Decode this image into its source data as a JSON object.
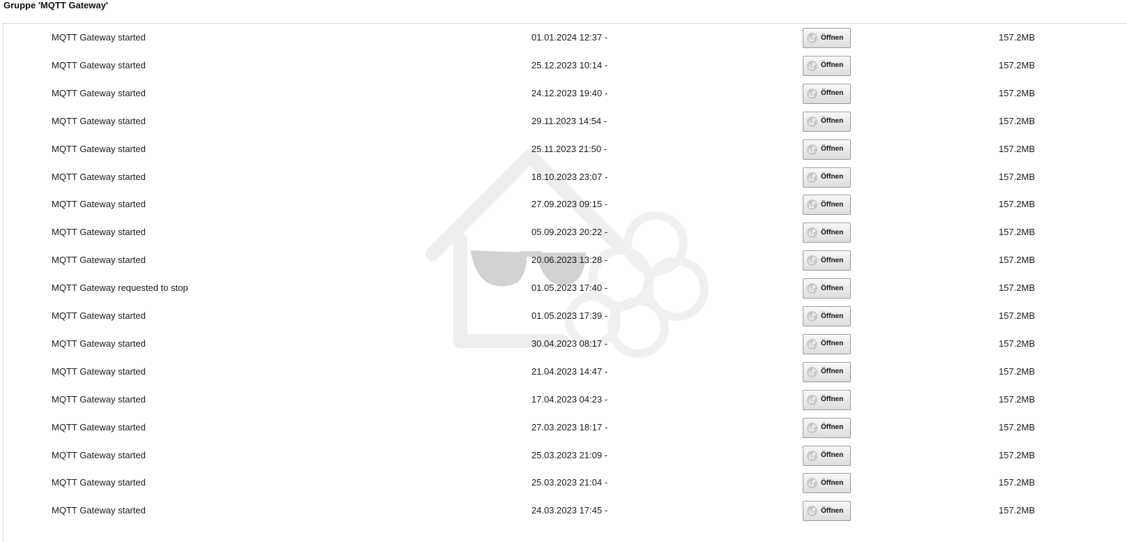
{
  "page": {
    "title": "Gruppe 'MQTT Gateway'"
  },
  "watermark": {
    "icon": "home-sunglasses-raspberry-logo"
  },
  "open_button": {
    "label": "Öffnen",
    "icon": "open-external-icon"
  },
  "rows": [
    {
      "message": "MQTT Gateway started",
      "date": "01.01.2024 12:37 -",
      "size": "157.2MB"
    },
    {
      "message": "MQTT Gateway started",
      "date": "25.12.2023 10:14 -",
      "size": "157.2MB"
    },
    {
      "message": "MQTT Gateway started",
      "date": "24.12.2023 19:40 -",
      "size": "157.2MB"
    },
    {
      "message": "MQTT Gateway started",
      "date": "29.11.2023 14:54 -",
      "size": "157.2MB"
    },
    {
      "message": "MQTT Gateway started",
      "date": "25.11.2023 21:50 -",
      "size": "157.2MB"
    },
    {
      "message": "MQTT Gateway started",
      "date": "18.10.2023 23:07 -",
      "size": "157.2MB"
    },
    {
      "message": "MQTT Gateway started",
      "date": "27.09.2023 09:15 -",
      "size": "157.2MB"
    },
    {
      "message": "MQTT Gateway started",
      "date": "05.09.2023 20:22 -",
      "size": "157.2MB"
    },
    {
      "message": "MQTT Gateway started",
      "date": "20.06.2023 13:28 -",
      "size": "157.2MB"
    },
    {
      "message": "MQTT Gateway requested to stop",
      "date": "01.05.2023 17:40 -",
      "size": "157.2MB"
    },
    {
      "message": "MQTT Gateway started",
      "date": "01.05.2023 17:39 -",
      "size": "157.2MB"
    },
    {
      "message": "MQTT Gateway started",
      "date": "30.04.2023 08:17 -",
      "size": "157.2MB"
    },
    {
      "message": "MQTT Gateway started",
      "date": "21.04.2023 14:47 -",
      "size": "157.2MB"
    },
    {
      "message": "MQTT Gateway started",
      "date": "17.04.2023 04:23 -",
      "size": "157.2MB"
    },
    {
      "message": "MQTT Gateway started",
      "date": "27.03.2023 18:17 -",
      "size": "157.2MB"
    },
    {
      "message": "MQTT Gateway started",
      "date": "25.03.2023 21:09 -",
      "size": "157.2MB"
    },
    {
      "message": "MQTT Gateway started",
      "date": "25.03.2023 21:04 -",
      "size": "157.2MB"
    },
    {
      "message": "MQTT Gateway started",
      "date": "24.03.2023 17:45 -",
      "size": "157.2MB"
    }
  ]
}
